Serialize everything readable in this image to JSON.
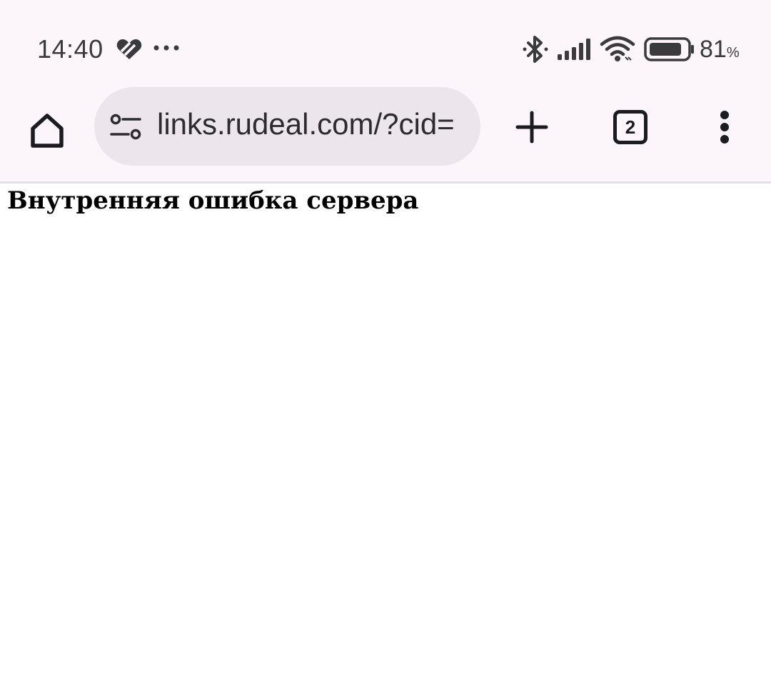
{
  "status_bar": {
    "time": "14:40",
    "notification_icons": [
      "health-heart-icon",
      "more-dots-icon"
    ],
    "system_icons": [
      "bluetooth-icon",
      "cellular-signal-icon",
      "wifi-icon",
      "battery-icon"
    ],
    "battery_percent": "81",
    "battery_unit": "%",
    "battery_level": 0.81
  },
  "toolbar": {
    "url": "links.rudeal.com/?cid=",
    "tab_count": "2",
    "icons": [
      "home-icon",
      "site-info-icon",
      "plus-icon",
      "tab-switcher-icon",
      "more-vert-icon"
    ]
  },
  "page": {
    "heading": "Внутренняя ошибка сервера"
  },
  "colors": {
    "chrome_background": "#fcf6fb",
    "omnibox_background": "#ece6ec",
    "icon_color": "#1c1b1f",
    "status_text": "#3b3a3d"
  }
}
